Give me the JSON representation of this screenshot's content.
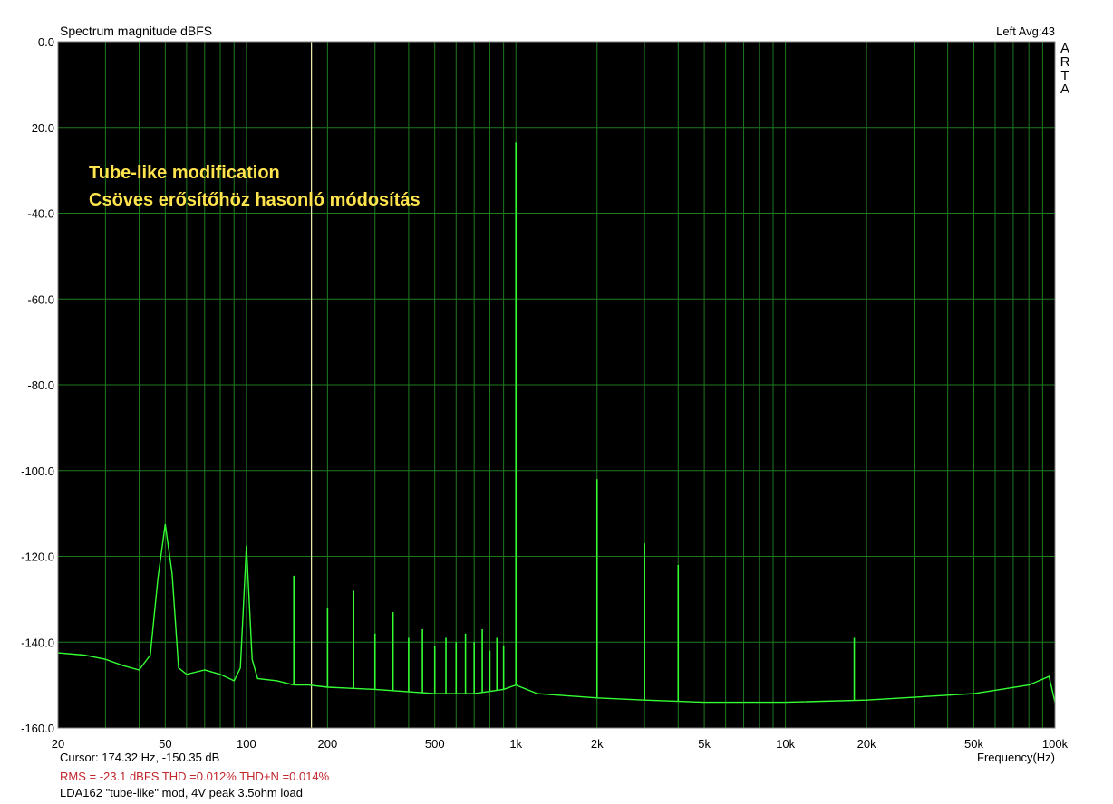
{
  "chart_data": {
    "type": "line",
    "title": "Spectrum magnitude dBFS",
    "xlabel": "Frequency(Hz)",
    "ylabel": "",
    "x_scale": "log",
    "xlim": [
      20,
      100000
    ],
    "ylim": [
      -160,
      0
    ],
    "grid": true,
    "x_ticks": [
      {
        "value": 20,
        "label": "20"
      },
      {
        "value": 50,
        "label": "50"
      },
      {
        "value": 100,
        "label": "100"
      },
      {
        "value": 200,
        "label": "200"
      },
      {
        "value": 500,
        "label": "500"
      },
      {
        "value": 1000,
        "label": "1k"
      },
      {
        "value": 2000,
        "label": "2k"
      },
      {
        "value": 5000,
        "label": "5k"
      },
      {
        "value": 10000,
        "label": "10k"
      },
      {
        "value": 20000,
        "label": "20k"
      },
      {
        "value": 50000,
        "label": "50k"
      },
      {
        "value": 100000,
        "label": "100k"
      }
    ],
    "y_ticks": [
      {
        "value": 0,
        "label": "0.0"
      },
      {
        "value": -20,
        "label": "-20.0"
      },
      {
        "value": -40,
        "label": "-40.0"
      },
      {
        "value": -60,
        "label": "-60.0"
      },
      {
        "value": -80,
        "label": "-80.0"
      },
      {
        "value": -100,
        "label": "-100.0"
      },
      {
        "value": -120,
        "label": "-120.0"
      },
      {
        "value": -140,
        "label": "-140.0"
      },
      {
        "value": -160,
        "label": "-160.0"
      }
    ],
    "series": [
      {
        "color": "#33ff33",
        "x": [
          20,
          25,
          30,
          35,
          40,
          44,
          47,
          50,
          53,
          56,
          60,
          70,
          80,
          90,
          95,
          100,
          105,
          110,
          130,
          150,
          170,
          200,
          300,
          500,
          700,
          900,
          1000,
          1200,
          2000,
          3000,
          5000,
          10000,
          20000,
          50000,
          80000,
          95000,
          100000
        ],
        "y": [
          -142.5,
          -143,
          -144,
          -145.5,
          -146.5,
          -143,
          -125,
          -112.5,
          -124,
          -146,
          -147.5,
          -146.5,
          -147.5,
          -149,
          -146,
          -117.5,
          -144,
          -148.5,
          -149,
          -150,
          -150,
          -150.5,
          -151,
          -152,
          -152,
          -151,
          -150,
          -152,
          -153,
          -153.5,
          -154,
          -154,
          -153.5,
          -152,
          -150,
          -148,
          -154
        ]
      }
    ],
    "spikes": [
      {
        "x": 150,
        "y": -124.5
      },
      {
        "x": 200,
        "y": -132
      },
      {
        "x": 250,
        "y": -128
      },
      {
        "x": 300,
        "y": -138
      },
      {
        "x": 350,
        "y": -133
      },
      {
        "x": 400,
        "y": -139
      },
      {
        "x": 450,
        "y": -137
      },
      {
        "x": 500,
        "y": -141
      },
      {
        "x": 550,
        "y": -139
      },
      {
        "x": 600,
        "y": -140
      },
      {
        "x": 650,
        "y": -138
      },
      {
        "x": 700,
        "y": -140
      },
      {
        "x": 750,
        "y": -137
      },
      {
        "x": 800,
        "y": -142
      },
      {
        "x": 850,
        "y": -139
      },
      {
        "x": 900,
        "y": -141
      },
      {
        "x": 1000,
        "y": -23.5
      },
      {
        "x": 2000,
        "y": -102
      },
      {
        "x": 3000,
        "y": -117
      },
      {
        "x": 4000,
        "y": -122
      },
      {
        "x": 18000,
        "y": -139
      }
    ],
    "annotations": [
      {
        "text": "Tube-like modification"
      },
      {
        "text": "Csöves erősítőhöz hasonló módosítás"
      }
    ],
    "annotation_color": "#ffe44d",
    "cursor_frequency": 174.32,
    "background_color": "#000000",
    "grid_color": "#1f7a1f",
    "cursor_color": "#f2f2b0"
  },
  "header": {
    "channel_avg": "Left  Avg:43",
    "brand_letters": [
      "A",
      "R",
      "T",
      "A"
    ]
  },
  "footer": {
    "cursor_readout": "Cursor: 174.32 Hz, -150.35 dB",
    "metrics": "RMS =  -23.1 dBFS   THD =0.012%   THD+N =0.014%",
    "caption": "LDA162 \"tube-like\" mod, 4V peak 3.5ohm load"
  }
}
